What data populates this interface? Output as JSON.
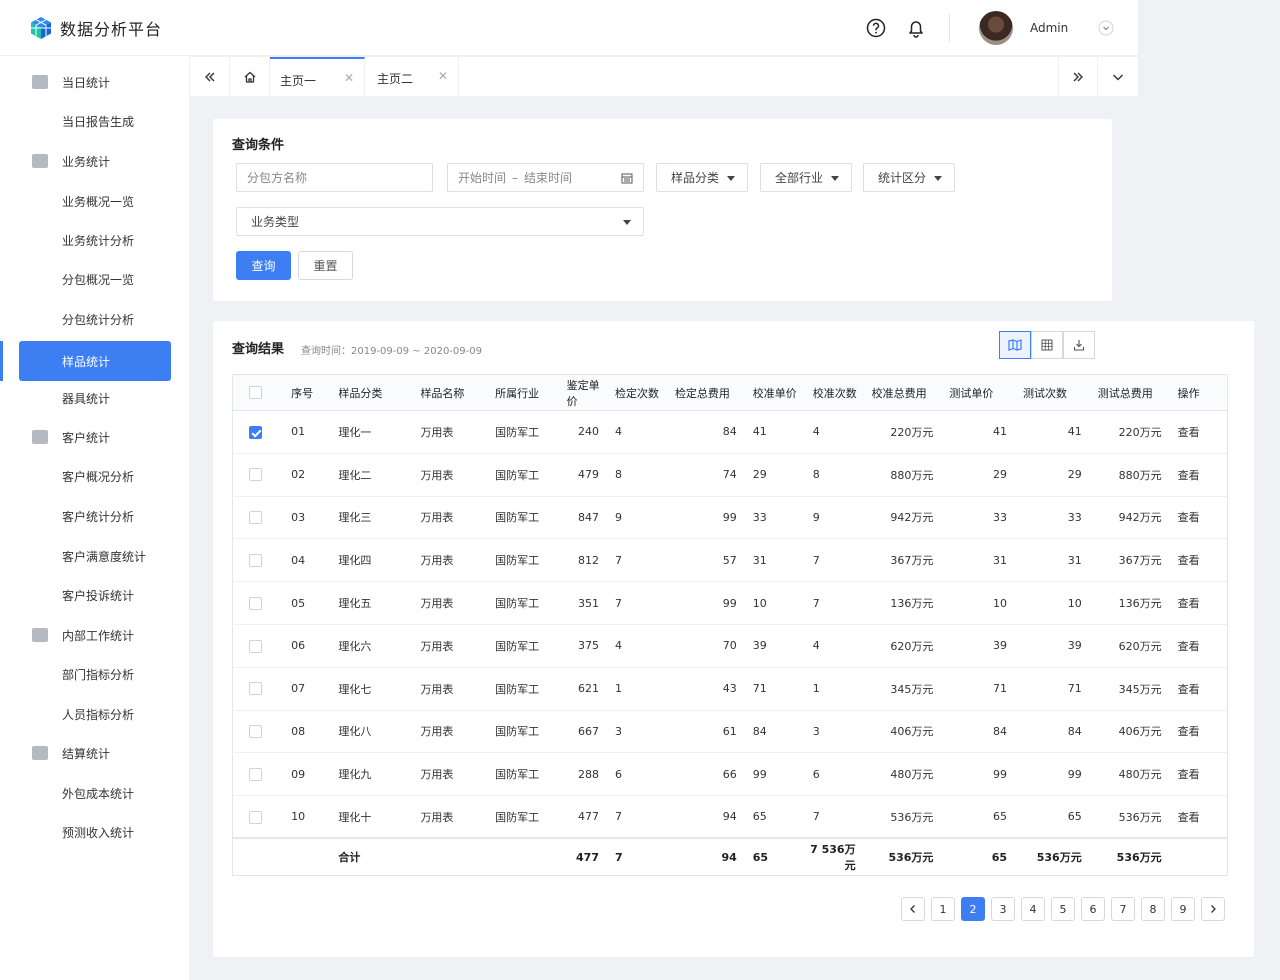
{
  "app": {
    "title": "数据分析平台"
  },
  "header": {
    "user_name": "Admin"
  },
  "sidebar": {
    "items": [
      {
        "label": "当日统计",
        "icon": "calendar-check-icon",
        "group": true
      },
      {
        "label": "当日报告生成",
        "group": false
      },
      {
        "label": "业务统计",
        "icon": "bar-chart-icon",
        "group": true
      },
      {
        "label": "业务概况一览",
        "group": false
      },
      {
        "label": "业务统计分析",
        "group": false
      },
      {
        "label": "分包概况一览",
        "group": false
      },
      {
        "label": "分包统计分析",
        "group": false
      },
      {
        "label": "样品统计",
        "group": false,
        "active": true
      },
      {
        "label": "器具统计",
        "group": false
      },
      {
        "label": "客户统计",
        "icon": "id-card-icon",
        "group": true
      },
      {
        "label": "客户概况分析",
        "group": false
      },
      {
        "label": "客户统计分析",
        "group": false
      },
      {
        "label": "客户满意度统计",
        "group": false
      },
      {
        "label": "客户投诉统计",
        "group": false
      },
      {
        "label": "内部工作统计",
        "icon": "line-chart-icon",
        "group": true
      },
      {
        "label": "部门指标分析",
        "group": false
      },
      {
        "label": "人员指标分析",
        "group": false
      },
      {
        "label": "结算统计",
        "icon": "yen-icon",
        "group": true
      },
      {
        "label": "外包成本统计",
        "group": false
      },
      {
        "label": "预测收入统计",
        "group": false
      }
    ]
  },
  "tabs": [
    {
      "label": "主页一",
      "active": true
    },
    {
      "label": "主页二",
      "active": false
    }
  ],
  "query": {
    "title": "查询条件",
    "subcontractor_placeholder": "分包方名称",
    "start_placeholder": "开始时间",
    "range_sep": "–",
    "end_placeholder": "结束时间",
    "sample_category": "样品分类",
    "industry": "全部行业",
    "stat_type": "统计区分",
    "business_type": "业务类型",
    "search_label": "查询",
    "reset_label": "重置"
  },
  "results": {
    "title": "查询结果",
    "query_time": "查询时间：2019-09-09 ~ 2020-09-09",
    "columns": [
      "序号",
      "样品分类",
      "样品名称",
      "所属行业",
      "鉴定单价",
      "检定次数",
      "检定总费用",
      "校准单价",
      "校准次数",
      "校准总费用",
      "测试单价",
      "测试次数",
      "测试总费用",
      "操作"
    ],
    "rows": [
      {
        "checked": true,
        "cells": [
          "01",
          "理化一",
          "万用表",
          "国防军工",
          "240",
          "4",
          "84",
          "41",
          "4",
          "220万元",
          "41",
          "41",
          "220万元",
          "查看"
        ]
      },
      {
        "checked": false,
        "cells": [
          "02",
          "理化二",
          "万用表",
          "国防军工",
          "479",
          "8",
          "74",
          "29",
          "8",
          "880万元",
          "29",
          "29",
          "880万元",
          "查看"
        ]
      },
      {
        "checked": false,
        "cells": [
          "03",
          "理化三",
          "万用表",
          "国防军工",
          "847",
          "9",
          "99",
          "33",
          "9",
          "942万元",
          "33",
          "33",
          "942万元",
          "查看"
        ]
      },
      {
        "checked": false,
        "cells": [
          "04",
          "理化四",
          "万用表",
          "国防军工",
          "812",
          "7",
          "57",
          "31",
          "7",
          "367万元",
          "31",
          "31",
          "367万元",
          "查看"
        ]
      },
      {
        "checked": false,
        "cells": [
          "05",
          "理化五",
          "万用表",
          "国防军工",
          "351",
          "7",
          "99",
          "10",
          "7",
          "136万元",
          "10",
          "10",
          "136万元",
          "查看"
        ]
      },
      {
        "checked": false,
        "cells": [
          "06",
          "理化六",
          "万用表",
          "国防军工",
          "375",
          "4",
          "70",
          "39",
          "4",
          "620万元",
          "39",
          "39",
          "620万元",
          "查看"
        ]
      },
      {
        "checked": false,
        "cells": [
          "07",
          "理化七",
          "万用表",
          "国防军工",
          "621",
          "1",
          "43",
          "71",
          "1",
          "345万元",
          "71",
          "71",
          "345万元",
          "查看"
        ]
      },
      {
        "checked": false,
        "cells": [
          "08",
          "理化八",
          "万用表",
          "国防军工",
          "667",
          "3",
          "61",
          "84",
          "3",
          "406万元",
          "84",
          "84",
          "406万元",
          "查看"
        ]
      },
      {
        "checked": false,
        "cells": [
          "09",
          "理化九",
          "万用表",
          "国防军工",
          "288",
          "6",
          "66",
          "99",
          "6",
          "480万元",
          "99",
          "99",
          "480万元",
          "查看"
        ]
      },
      {
        "checked": false,
        "cells": [
          "10",
          "理化十",
          "万用表",
          "国防军工",
          "477",
          "7",
          "94",
          "65",
          "7",
          "536万元",
          "65",
          "65",
          "536万元",
          "查看"
        ]
      }
    ],
    "total": [
      "",
      "合计",
      "",
      "",
      "477",
      "7",
      "94",
      "65",
      "7  536万元",
      "536万元",
      "65",
      "536万元",
      "536万元",
      ""
    ]
  },
  "pagination": {
    "pages": [
      "1",
      "2",
      "3",
      "4",
      "5",
      "6",
      "7",
      "8",
      "9"
    ],
    "current": "2"
  },
  "colors": {
    "accent": "#3d7ef3"
  }
}
